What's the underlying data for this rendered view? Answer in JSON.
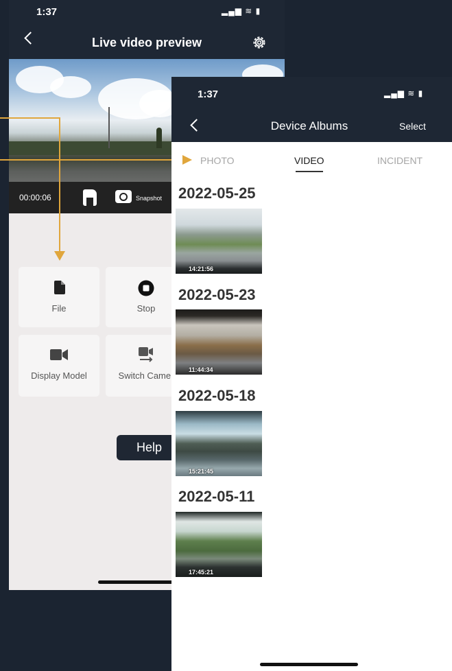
{
  "preview_screen": {
    "status_time": "1:37",
    "status_icons": "▂▄▆ ≋ ▮",
    "title": "Live video preview",
    "timer": "00:00:06",
    "snapshot_label": "Snapshot",
    "tiles": [
      {
        "label": "File",
        "icon": "file-icon"
      },
      {
        "label": "Stop",
        "icon": "stop-icon"
      },
      {
        "label": "Display Model",
        "icon": "video-camera-icon"
      },
      {
        "label": "Switch Camer",
        "icon": "switch-camera-icon"
      }
    ],
    "help_label": "Help"
  },
  "albums_screen": {
    "status_time": "1:37",
    "status_icons": "▂▄▆ ≋ ▮",
    "title": "Device Albums",
    "select_label": "Select",
    "tabs": [
      {
        "label": "PHOTO",
        "active": false
      },
      {
        "label": "VIDEO",
        "active": true
      },
      {
        "label": "INCIDENT",
        "active": false
      }
    ],
    "groups": [
      {
        "date": "2022-05-25",
        "time": "14:21:56"
      },
      {
        "date": "2022-05-23",
        "time": "11:44:34"
      },
      {
        "date": "2022-05-18",
        "time": "15:21:45"
      },
      {
        "date": "2022-05-11",
        "time": "17:45:21"
      }
    ]
  },
  "colors": {
    "background": "#1b2431",
    "header": "#1e2734",
    "annotation_arrow": "#e0a63c"
  }
}
